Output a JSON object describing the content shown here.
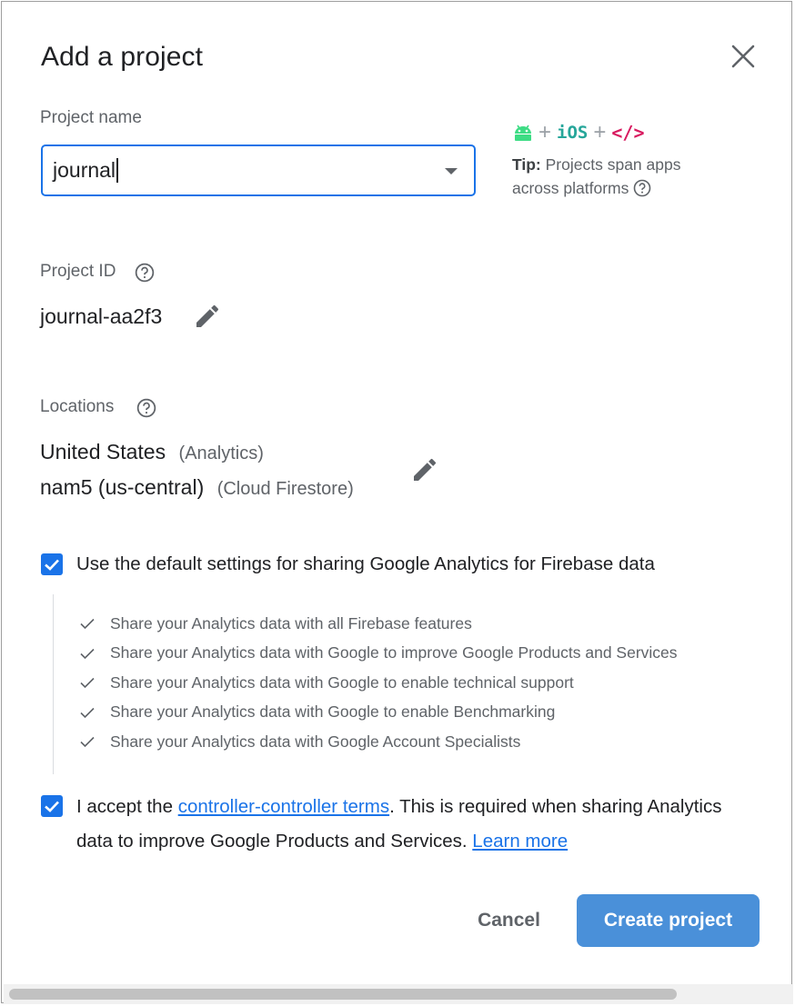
{
  "dialog": {
    "title": "Add a project"
  },
  "project_name": {
    "label": "Project name",
    "value": "journal"
  },
  "tip": {
    "ios_label": "iOS",
    "web_label": "</>",
    "bold": "Tip:",
    "text": " Projects span apps across platforms"
  },
  "project_id": {
    "label": "Project ID",
    "value": "journal-aa2f3"
  },
  "locations": {
    "label": "Locations",
    "rows": [
      {
        "value": "United States",
        "note": "(Analytics)"
      },
      {
        "value": "nam5 (us-central)",
        "note": "(Cloud Firestore)"
      }
    ]
  },
  "analytics": {
    "default_label": "Use the default settings for sharing Google Analytics for Firebase data",
    "items": [
      "Share your Analytics data with all Firebase features",
      "Share your Analytics data with Google to improve Google Products and Services",
      "Share your Analytics data with Google to enable technical support",
      "Share your Analytics data with Google to enable Benchmarking",
      "Share your Analytics data with Google Account Specialists"
    ]
  },
  "accept": {
    "prefix": "I accept the ",
    "link": "controller-controller terms",
    "middle": ". This is required when sharing Analytics data to improve Google Products and Services. ",
    "learn_more": "Learn more"
  },
  "actions": {
    "cancel": "Cancel",
    "create": "Create project"
  },
  "colors": {
    "accent": "#1a73e8",
    "primary_button": "#4a90d9",
    "android_green": "#3ddc84",
    "ios_teal": "#26a69a",
    "web_pink": "#d81b60"
  }
}
